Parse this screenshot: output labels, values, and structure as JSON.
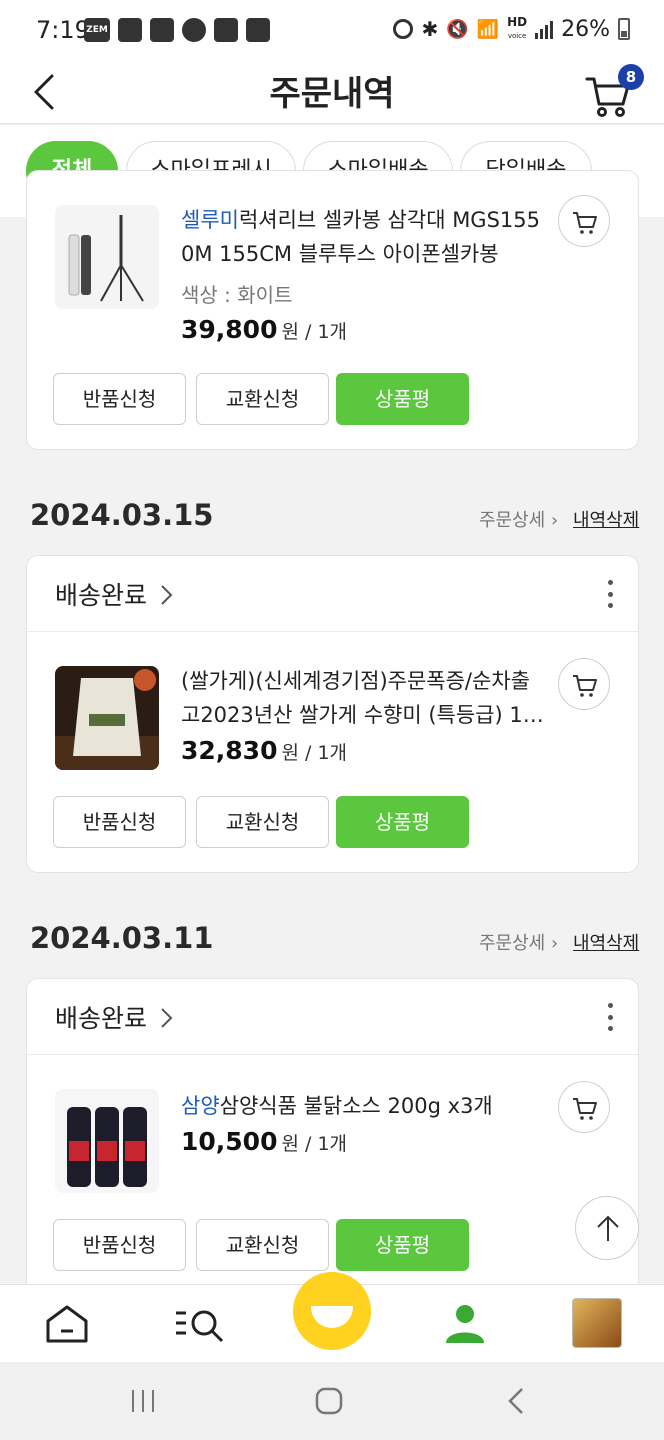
{
  "status_bar": {
    "time": "7:19",
    "battery": "26%",
    "hd_label": "HD",
    "voice_label": "voice",
    "zem_label": "ZEM"
  },
  "header": {
    "title": "주문내역",
    "cart_count": "8"
  },
  "filters": [
    {
      "label": "전체",
      "active": true
    },
    {
      "label": "스마일프레시",
      "active": false
    },
    {
      "label": "스마일배송",
      "active": false
    },
    {
      "label": "당일배송",
      "active": false
    }
  ],
  "orders": [
    {
      "brand": "셀루미",
      "name_line1": "럭셔리브 셀카봉 삼각대 MGS155",
      "name_line2": "0M 155CM 블루투스 아이폰셀카봉",
      "option": "색상 : 화이트",
      "price": "39,800",
      "price_suffix": "원 / 1개"
    },
    {
      "date": "2024.03.15",
      "status": "배송완료",
      "name_line1": "(쌀가게)(신세계경기점)주문폭증/순차출",
      "name_line2": "고2023년산 쌀가게 수향미 (특등급) 1…",
      "price": "32,830",
      "price_suffix": "원 / 1개"
    },
    {
      "date": "2024.03.11",
      "status": "배송완료",
      "brand": "삼양",
      "name_line1": "삼양식품 불닭소스 200g x3개",
      "price": "10,500",
      "price_suffix": "원 / 1개"
    }
  ],
  "order_links": {
    "detail": "주문상세 ›",
    "delete": "내역삭제"
  },
  "buttons": {
    "return": "반품신청",
    "exchange": "교환신청",
    "review": "상품평"
  },
  "colors": {
    "accent_green": "#5ac73f",
    "badge_blue": "#1c3fa8",
    "brand_blue": "#1f5bb8",
    "smile_yellow": "#ffd21f"
  }
}
